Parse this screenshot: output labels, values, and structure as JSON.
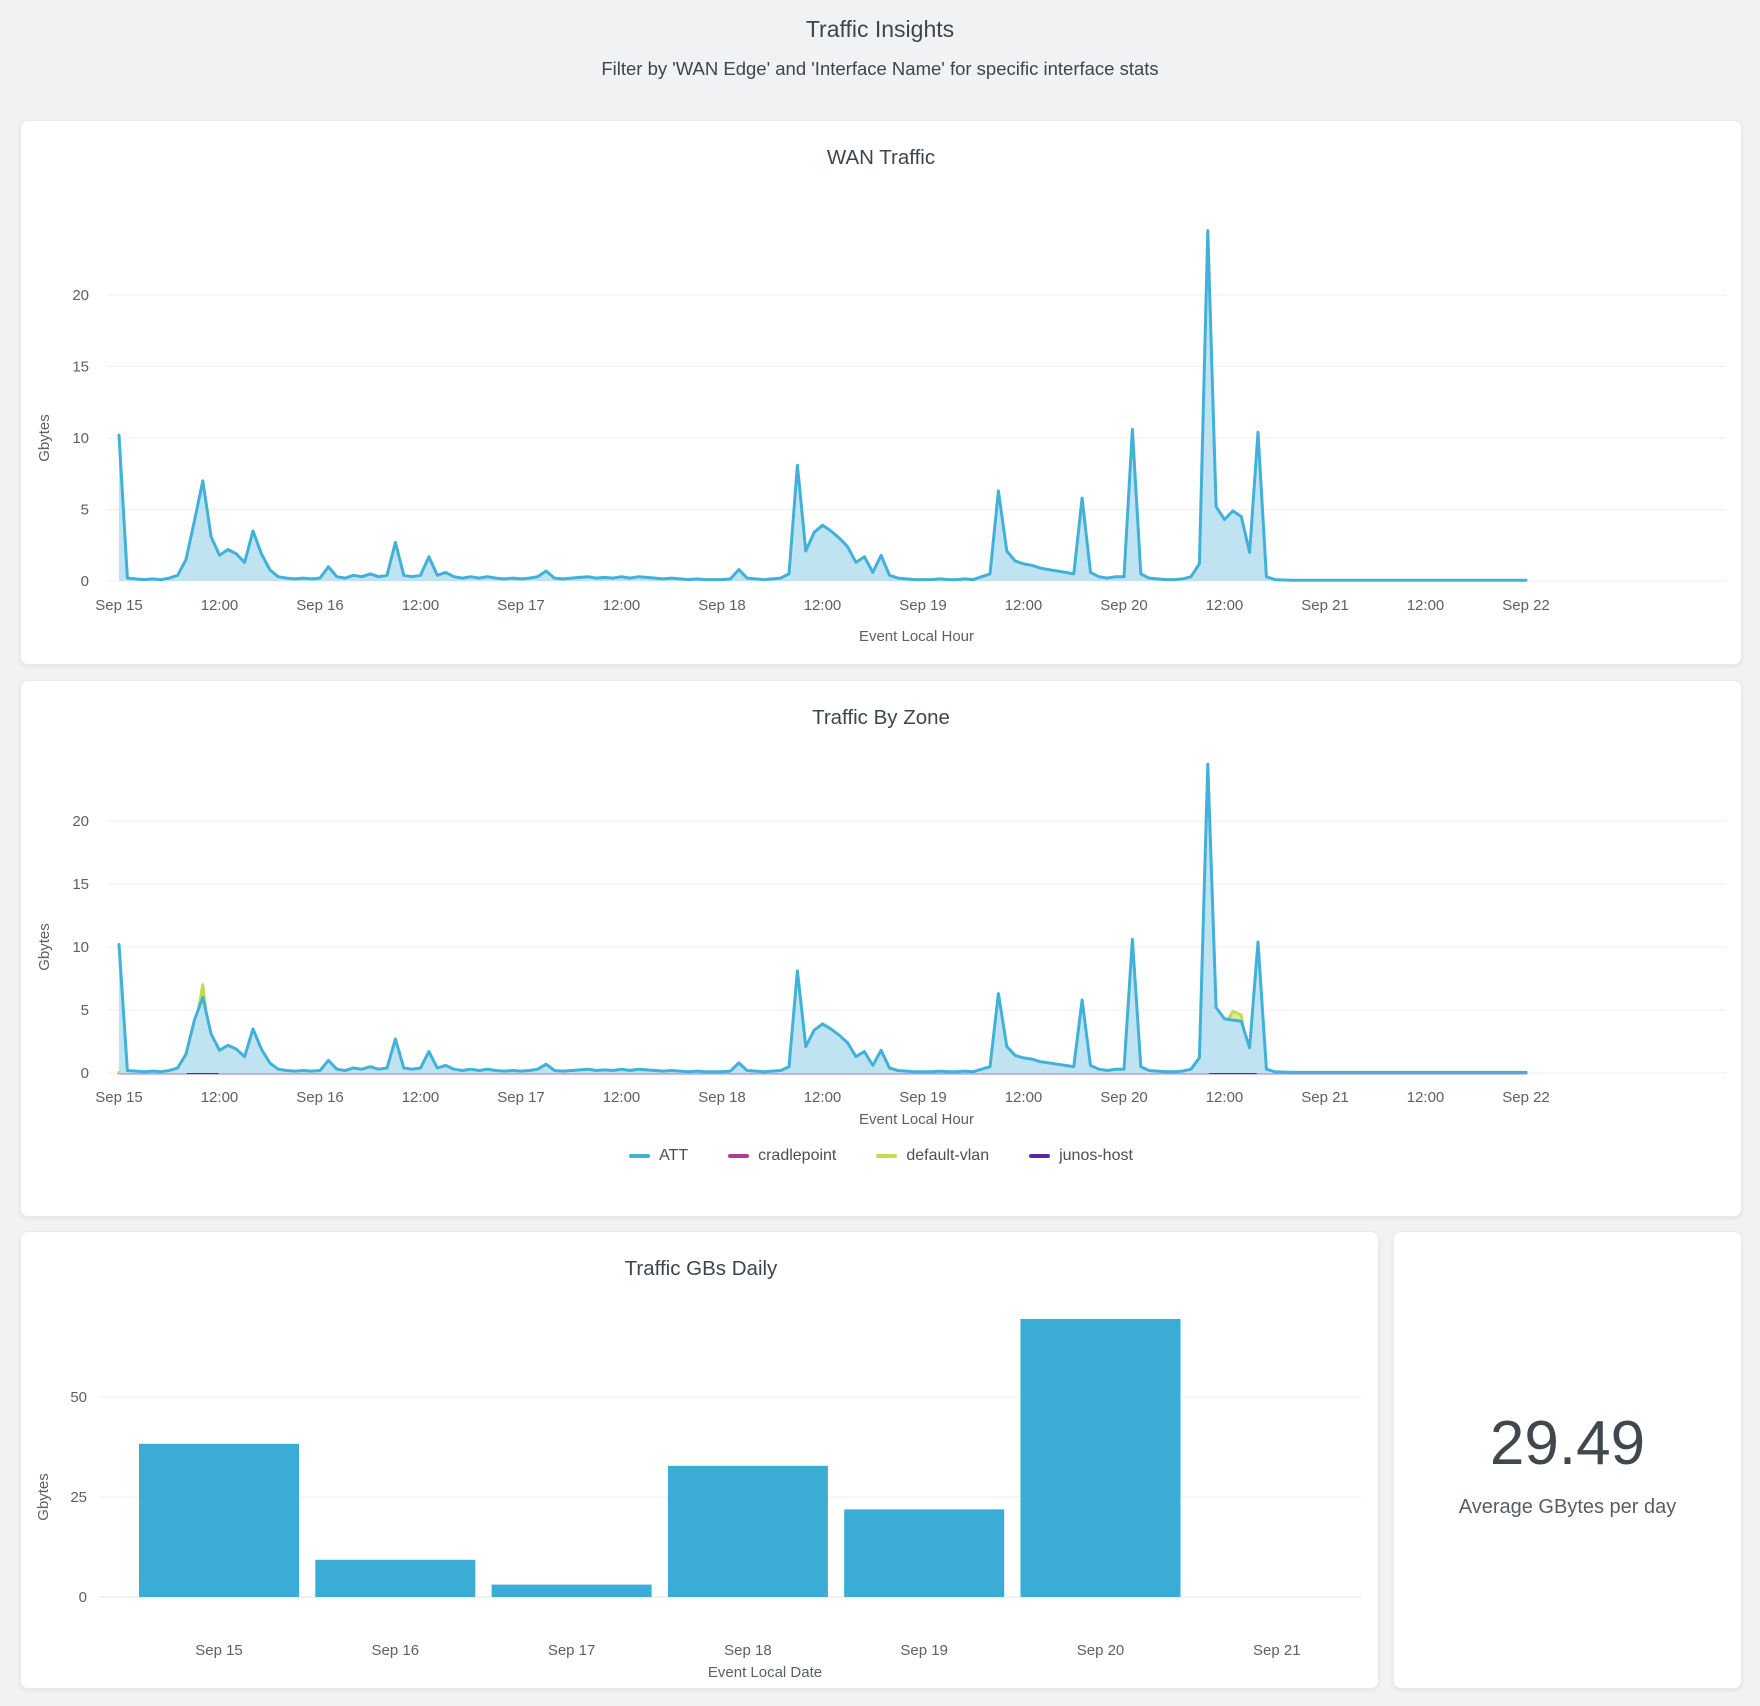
{
  "page": {
    "title": "Traffic Insights",
    "subtitle": "Filter by 'WAN Edge' and 'Interface Name' for specific interface stats"
  },
  "colors": {
    "att": "#41b1d9",
    "area_fill": "#c0e3f2",
    "cradlepoint": "#b13a99",
    "default_vlan": "#c3da52",
    "default_vlan_fill": "rgba(195,218,82,0.55)",
    "junos_host": "#5b27a5",
    "bar": "#3aacd6",
    "grid": "#edeff1",
    "axis_line": "#dfe3e7",
    "text": "#3d454d",
    "muted": "#5b6167"
  },
  "chart_data": [
    {
      "type": "area",
      "title": "WAN Traffic",
      "xlabel": "Event Local Hour",
      "ylabel": "Gbytes",
      "ylim": [
        0,
        25
      ],
      "yticks": [
        0,
        5,
        10,
        15,
        20
      ],
      "x_range_hours": 168,
      "grid": true,
      "xticks": [
        [
          0,
          "Sep 15"
        ],
        [
          12,
          "12:00"
        ],
        [
          24,
          "Sep 16"
        ],
        [
          36,
          "12:00"
        ],
        [
          48,
          "Sep 17"
        ],
        [
          60,
          "12:00"
        ],
        [
          72,
          "Sep 18"
        ],
        [
          84,
          "12:00"
        ],
        [
          96,
          "Sep 19"
        ],
        [
          108,
          "12:00"
        ],
        [
          120,
          "Sep 20"
        ],
        [
          132,
          "12:00"
        ],
        [
          144,
          "Sep 21"
        ],
        [
          156,
          "12:00"
        ],
        [
          168,
          "Sep 22"
        ]
      ],
      "series": [
        {
          "name": "WAN",
          "color": "#41b1d9",
          "fill": "#c0e3f2",
          "points": [
            [
              0,
              10.2
            ],
            [
              1,
              0.2
            ],
            [
              2,
              0.15
            ],
            [
              3,
              0.1
            ],
            [
              4,
              0.15
            ],
            [
              5,
              0.1
            ],
            [
              6,
              0.2
            ],
            [
              7,
              0.4
            ],
            [
              8,
              1.5
            ],
            [
              9,
              4.2
            ],
            [
              10,
              7
            ],
            [
              11,
              3.1
            ],
            [
              12,
              1.8
            ],
            [
              13,
              2.2
            ],
            [
              14,
              1.9
            ],
            [
              15,
              1.3
            ],
            [
              16,
              3.5
            ],
            [
              17,
              1.9
            ],
            [
              18,
              0.8
            ],
            [
              19,
              0.3
            ],
            [
              20,
              0.2
            ],
            [
              21,
              0.15
            ],
            [
              22,
              0.2
            ],
            [
              23,
              0.15
            ],
            [
              24,
              0.2
            ],
            [
              25,
              1
            ],
            [
              26,
              0.3
            ],
            [
              27,
              0.2
            ],
            [
              28,
              0.4
            ],
            [
              29,
              0.3
            ],
            [
              30,
              0.5
            ],
            [
              31,
              0.3
            ],
            [
              32,
              0.4
            ],
            [
              33,
              2.7
            ],
            [
              34,
              0.4
            ],
            [
              35,
              0.3
            ],
            [
              36,
              0.4
            ],
            [
              37,
              1.7
            ],
            [
              38,
              0.4
            ],
            [
              39,
              0.6
            ],
            [
              40,
              0.3
            ],
            [
              41,
              0.2
            ],
            [
              42,
              0.3
            ],
            [
              43,
              0.2
            ],
            [
              44,
              0.3
            ],
            [
              45,
              0.2
            ],
            [
              46,
              0.15
            ],
            [
              47,
              0.2
            ],
            [
              48,
              0.15
            ],
            [
              49,
              0.2
            ],
            [
              50,
              0.3
            ],
            [
              51,
              0.7
            ],
            [
              52,
              0.2
            ],
            [
              53,
              0.15
            ],
            [
              54,
              0.2
            ],
            [
              55,
              0.25
            ],
            [
              56,
              0.3
            ],
            [
              57,
              0.2
            ],
            [
              58,
              0.25
            ],
            [
              59,
              0.2
            ],
            [
              60,
              0.3
            ],
            [
              61,
              0.2
            ],
            [
              62,
              0.3
            ],
            [
              63,
              0.25
            ],
            [
              64,
              0.2
            ],
            [
              65,
              0.15
            ],
            [
              66,
              0.2
            ],
            [
              67,
              0.15
            ],
            [
              68,
              0.1
            ],
            [
              69,
              0.15
            ],
            [
              70,
              0.1
            ],
            [
              71,
              0.1
            ],
            [
              72,
              0.1
            ],
            [
              73,
              0.15
            ],
            [
              74,
              0.8
            ],
            [
              75,
              0.2
            ],
            [
              76,
              0.15
            ],
            [
              77,
              0.1
            ],
            [
              78,
              0.15
            ],
            [
              79,
              0.2
            ],
            [
              80,
              0.5
            ],
            [
              81,
              8.1
            ],
            [
              82,
              2.1
            ],
            [
              83,
              3.4
            ],
            [
              84,
              3.9
            ],
            [
              85,
              3.5
            ],
            [
              86,
              3
            ],
            [
              87,
              2.4
            ],
            [
              88,
              1.3
            ],
            [
              89,
              1.7
            ],
            [
              90,
              0.6
            ],
            [
              91,
              1.8
            ],
            [
              92,
              0.4
            ],
            [
              93,
              0.2
            ],
            [
              94,
              0.15
            ],
            [
              95,
              0.1
            ],
            [
              96,
              0.1
            ],
            [
              97,
              0.1
            ],
            [
              98,
              0.15
            ],
            [
              99,
              0.1
            ],
            [
              100,
              0.1
            ],
            [
              101,
              0.15
            ],
            [
              102,
              0.1
            ],
            [
              103,
              0.3
            ],
            [
              104,
              0.5
            ],
            [
              105,
              6.3
            ],
            [
              106,
              2.1
            ],
            [
              107,
              1.4
            ],
            [
              108,
              1.2
            ],
            [
              109,
              1.1
            ],
            [
              110,
              0.9
            ],
            [
              111,
              0.8
            ],
            [
              112,
              0.7
            ],
            [
              113,
              0.6
            ],
            [
              114,
              0.5
            ],
            [
              115,
              5.8
            ],
            [
              116,
              0.6
            ],
            [
              117,
              0.3
            ],
            [
              118,
              0.2
            ],
            [
              119,
              0.3
            ],
            [
              120,
              0.3
            ],
            [
              121,
              10.6
            ],
            [
              122,
              0.5
            ],
            [
              123,
              0.2
            ],
            [
              124,
              0.15
            ],
            [
              125,
              0.1
            ],
            [
              126,
              0.1
            ],
            [
              127,
              0.15
            ],
            [
              128,
              0.3
            ],
            [
              129,
              1.2
            ],
            [
              130,
              24.5
            ],
            [
              131,
              5.2
            ],
            [
              132,
              4.3
            ],
            [
              133,
              4.9
            ],
            [
              134,
              4.5
            ],
            [
              135,
              2
            ],
            [
              136,
              10.4
            ],
            [
              137,
              0.3
            ],
            [
              138,
              0.1
            ],
            [
              140,
              0.05
            ],
            [
              168,
              0.05
            ]
          ]
        }
      ]
    },
    {
      "type": "area",
      "title": "Traffic By Zone",
      "xlabel": "Event Local Hour",
      "ylabel": "Gbytes",
      "ylim": [
        0,
        25
      ],
      "yticks": [
        0,
        5,
        10,
        15,
        20
      ],
      "x_range_hours": 168,
      "grid": true,
      "legend_position": "bottom",
      "legend": [
        {
          "label": "ATT",
          "color_key": "att"
        },
        {
          "label": "cradlepoint",
          "color_key": "cradlepoint"
        },
        {
          "label": "default-vlan",
          "color_key": "default_vlan"
        },
        {
          "label": "junos-host",
          "color_key": "junos_host"
        }
      ],
      "xticks": [
        [
          0,
          "Sep 15"
        ],
        [
          12,
          "12:00"
        ],
        [
          24,
          "Sep 16"
        ],
        [
          36,
          "12:00"
        ],
        [
          48,
          "Sep 17"
        ],
        [
          60,
          "12:00"
        ],
        [
          72,
          "Sep 18"
        ],
        [
          84,
          "12:00"
        ],
        [
          96,
          "Sep 19"
        ],
        [
          108,
          "12:00"
        ],
        [
          120,
          "Sep 20"
        ],
        [
          132,
          "12:00"
        ],
        [
          144,
          "Sep 21"
        ],
        [
          156,
          "12:00"
        ],
        [
          168,
          "Sep 22"
        ]
      ],
      "series": [
        {
          "name": "cradlepoint",
          "color": "#b13a99",
          "flat": 0.03
        },
        {
          "name": "junos-host",
          "color": "#5b27a5",
          "flat": 0.02
        },
        {
          "name": "default-vlan",
          "color": "#c3da52",
          "fill": "rgba(195,218,82,0.55)",
          "points": [
            [
              0,
              0.05
            ],
            [
              8,
              0.05
            ],
            [
              9,
              3.2
            ],
            [
              10,
              7
            ],
            [
              11,
              1.5
            ],
            [
              12,
              0.05
            ],
            [
              130,
              0.05
            ],
            [
              131,
              0.3
            ],
            [
              132,
              3.8
            ],
            [
              133,
              4.9
            ],
            [
              134,
              4.6
            ],
            [
              135,
              0.4
            ],
            [
              136,
              0.05
            ],
            [
              168,
              0.05
            ]
          ]
        },
        {
          "name": "ATT",
          "color": "#41b1d9",
          "fill": "#c0e3f2",
          "points_ref": "chart_data.0.series.0.points",
          "overrides": [
            [
              10,
              6
            ],
            [
              133,
              4.2
            ],
            [
              134,
              4.1
            ]
          ]
        }
      ]
    },
    {
      "type": "bar",
      "title": "Traffic GBs Daily",
      "xlabel": "Event Local Date",
      "ylabel": "Gbytes",
      "categories": [
        "Sep 15",
        "Sep 16",
        "Sep 17",
        "Sep 18",
        "Sep 19",
        "Sep 20",
        "Sep 21"
      ],
      "values": [
        38.3,
        9.3,
        3.1,
        32.8,
        21.9,
        69.5,
        0
      ],
      "yticks": [
        0,
        25,
        50
      ],
      "ylim": [
        0,
        75
      ],
      "grid": true
    },
    {
      "type": "stat",
      "value": "29.49",
      "label": "Average GBytes per day"
    }
  ]
}
